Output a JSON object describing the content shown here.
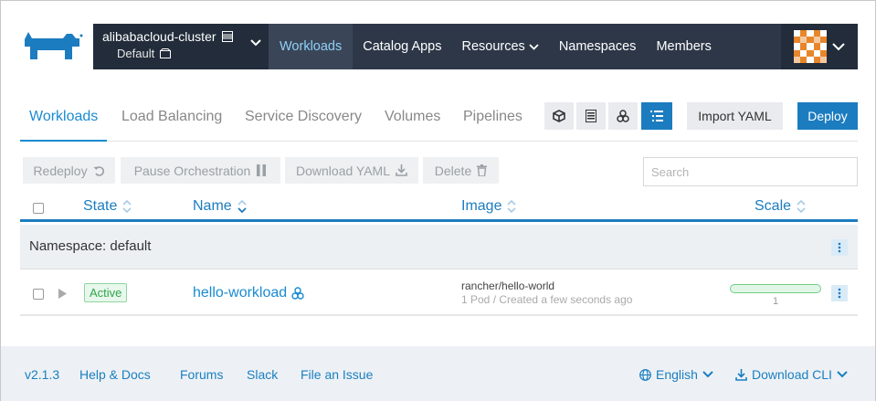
{
  "colors": {
    "accent": "#1c7cc0",
    "header_bg": "#2d3748",
    "active_green": "#2ea64b"
  },
  "header": {
    "cluster_name": "alibabacloud-cluster",
    "namespace": "Default",
    "nav": [
      {
        "label": "Workloads",
        "active": true
      },
      {
        "label": "Catalog Apps"
      },
      {
        "label": "Resources",
        "dropdown": true
      },
      {
        "label": "Namespaces"
      },
      {
        "label": "Members"
      }
    ]
  },
  "tabs": [
    {
      "label": "Workloads",
      "active": true
    },
    {
      "label": "Load Balancing"
    },
    {
      "label": "Service Discovery"
    },
    {
      "label": "Volumes"
    },
    {
      "label": "Pipelines"
    }
  ],
  "view_icons": [
    "cube-icon",
    "list-icon",
    "nodes-icon",
    "tree-list-icon"
  ],
  "buttons": {
    "import_yaml": "Import YAML",
    "deploy": "Deploy"
  },
  "actions": {
    "redeploy": "Redeploy",
    "pause": "Pause Orchestration",
    "download": "Download YAML",
    "delete": "Delete"
  },
  "search": {
    "placeholder": "Search"
  },
  "table": {
    "columns": {
      "state": "State",
      "name": "Name",
      "image": "Image",
      "scale": "Scale"
    },
    "namespace_row": "Namespace: default",
    "rows": [
      {
        "state": "Active",
        "name": "hello-workload",
        "image": "rancher/hello-world",
        "meta": "1 Pod / Created a few seconds ago",
        "scale": "1"
      }
    ]
  },
  "footer": {
    "version": "v2.1.3",
    "help": "Help & Docs",
    "forums": "Forums",
    "slack": "Slack",
    "issue": "File an Issue",
    "language": "English",
    "cli": "Download CLI"
  }
}
